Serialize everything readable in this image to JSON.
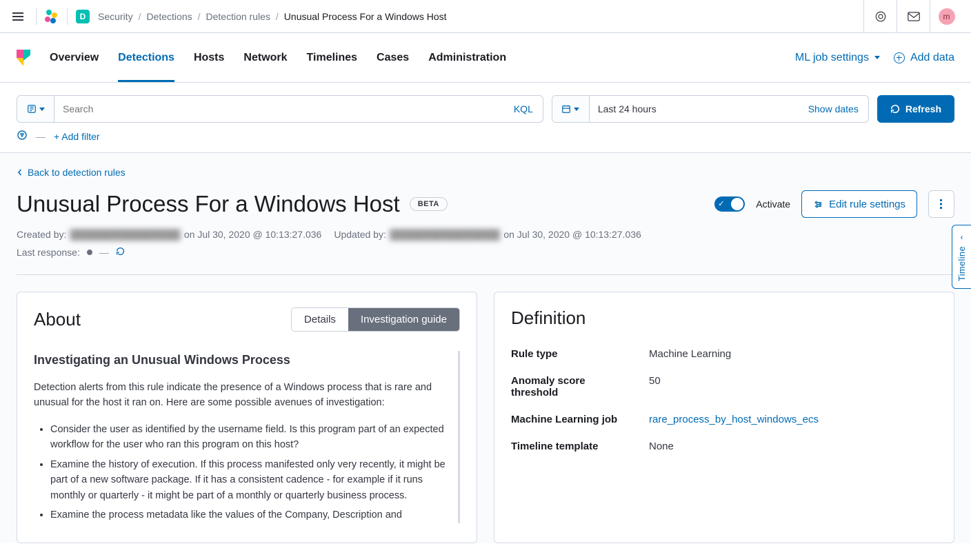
{
  "header": {
    "appInitial": "D",
    "breadcrumbs": [
      "Security",
      "Detections",
      "Detection rules"
    ],
    "breadcrumbCurrent": "Unusual Process For a Windows Host",
    "avatarInitial": "m"
  },
  "nav": {
    "tabs": [
      "Overview",
      "Detections",
      "Hosts",
      "Network",
      "Timelines",
      "Cases",
      "Administration"
    ],
    "activeTab": "Detections",
    "mlJob": "ML job settings",
    "addData": "Add data"
  },
  "search": {
    "placeholder": "Search",
    "kql": "KQL",
    "dateRange": "Last 24 hours",
    "showDates": "Show dates",
    "refresh": "Refresh",
    "addFilter": "+ Add filter"
  },
  "page": {
    "backLink": "Back to detection rules",
    "title": "Unusual Process For a Windows Host",
    "badge": "BETA",
    "activate": "Activate",
    "editRule": "Edit rule settings",
    "createdByLabel": "Created by:",
    "createdByUser": "████████████████",
    "createdOn": "on Jul 30, 2020 @ 10:13:27.036",
    "updatedByLabel": "Updated by:",
    "updatedByUser": "████████████████",
    "updatedOn": "on Jul 30, 2020 @ 10:13:27.036",
    "lastResponse": "Last response:",
    "lastResponseValue": "—"
  },
  "about": {
    "title": "About",
    "tabDetails": "Details",
    "tabGuide": "Investigation guide",
    "guideTitle": "Investigating an Unusual Windows Process",
    "intro": "Detection alerts from this rule indicate the presence of a Windows process that is rare and unusual for the host it ran on. Here are some possible avenues of investigation:",
    "bullets": [
      "Consider the user as identified by the username field. Is this program part of an expected workflow for the user who ran this program on this host?",
      "Examine the history of execution. If this process manifested only very recently, it might be part of a new software package. If it has a consistent cadence - for example if it runs monthly or quarterly - it might be part of a monthly or quarterly business process.",
      "Examine the process metadata like the values of the Company, Description and"
    ]
  },
  "definition": {
    "title": "Definition",
    "rows": [
      {
        "label": "Rule type",
        "value": "Machine Learning"
      },
      {
        "label": "Anomaly score threshold",
        "value": "50"
      },
      {
        "label": "Machine Learning job",
        "value": "rare_process_by_host_windows_ecs",
        "link": true
      },
      {
        "label": "Timeline template",
        "value": "None"
      }
    ]
  },
  "timelineFlyout": "Timeline"
}
